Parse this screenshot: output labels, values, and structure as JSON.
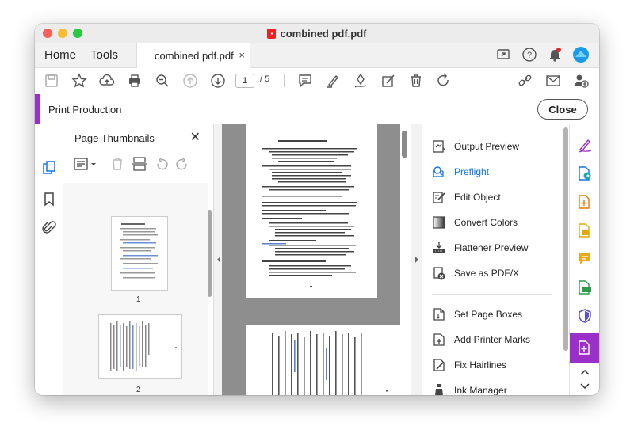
{
  "window": {
    "title": "combined pdf.pdf"
  },
  "tabs": {
    "home": "Home",
    "tools": "Tools",
    "file_tab": "combined pdf.pdf",
    "close_glyph": "×"
  },
  "toolbar": {
    "page_current": "1",
    "page_total": "/ 5"
  },
  "production_bar": {
    "title": "Print Production",
    "close_label": "Close"
  },
  "thumbnails": {
    "title": "Page Thumbnails",
    "close_glyph": "✕",
    "pages": [
      {
        "label": "1"
      },
      {
        "label": "2"
      }
    ]
  },
  "tools": {
    "group1": [
      {
        "label": "Output Preview",
        "icon": "output-preview-icon"
      },
      {
        "label": "Preflight",
        "icon": "preflight-icon",
        "active": true
      },
      {
        "label": "Edit Object",
        "icon": "edit-object-icon"
      },
      {
        "label": "Convert Colors",
        "icon": "convert-colors-icon"
      },
      {
        "label": "Flattener Preview",
        "icon": "flattener-preview-icon"
      },
      {
        "label": "Save as PDF/X",
        "icon": "save-as-pdfx-icon"
      }
    ],
    "group2": [
      {
        "label": "Set Page Boxes",
        "icon": "set-page-boxes-icon"
      },
      {
        "label": "Add Printer Marks",
        "icon": "add-printer-marks-icon"
      },
      {
        "label": "Fix Hairlines",
        "icon": "fix-hairlines-icon"
      },
      {
        "label": "Ink Manager",
        "icon": "ink-manager-icon"
      }
    ]
  },
  "colors": {
    "accent": "#9b2fc9",
    "link_blue": "#1473e6"
  }
}
